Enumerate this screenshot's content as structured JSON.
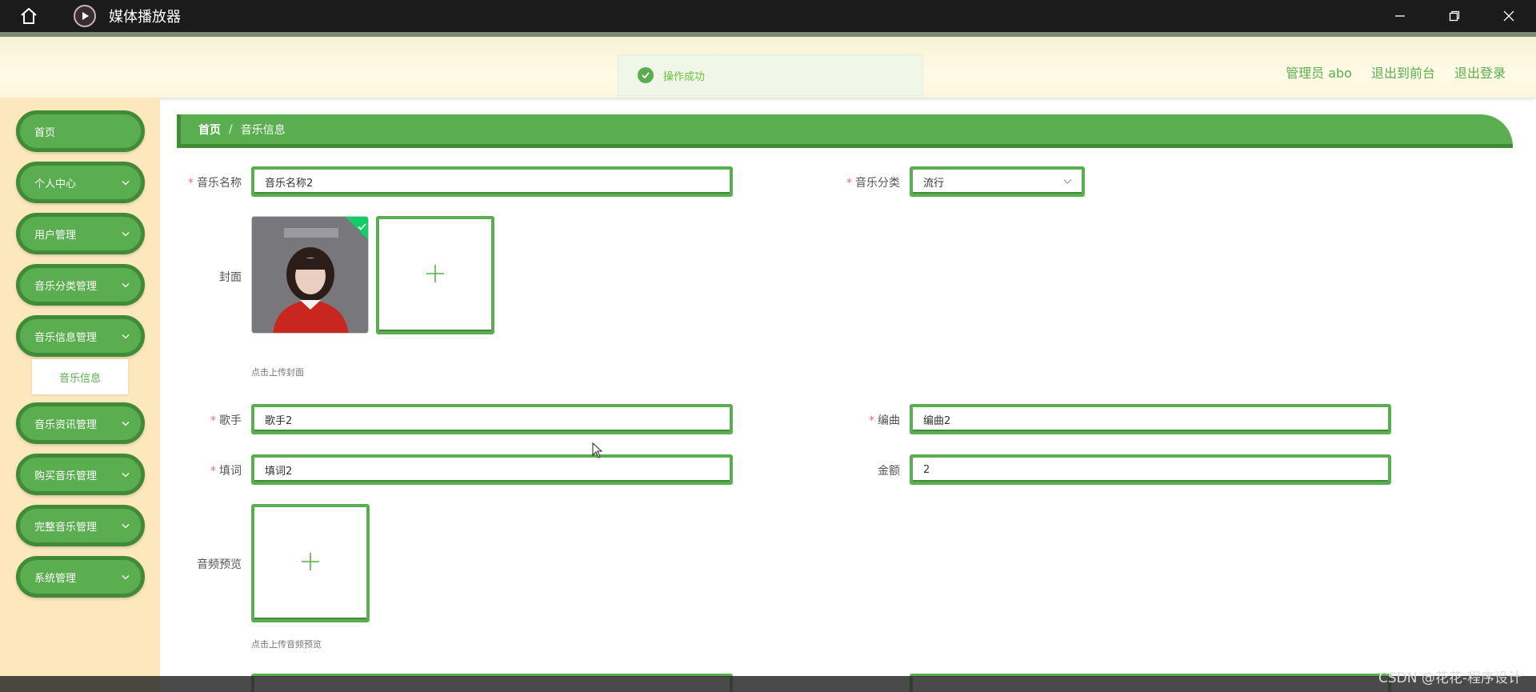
{
  "app": {
    "title": "媒体播放器"
  },
  "header": {
    "toast": "操作成功",
    "user": "管理员 abo",
    "front_link": "退出到前台",
    "logout": "退出登录"
  },
  "sidebar": {
    "items": [
      {
        "label": "首页"
      },
      {
        "label": "个人中心"
      },
      {
        "label": "用户管理"
      },
      {
        "label": "音乐分类管理"
      },
      {
        "label": "音乐信息管理"
      },
      {
        "label": "音乐资讯管理"
      },
      {
        "label": "购买音乐管理"
      },
      {
        "label": "完整音乐管理"
      },
      {
        "label": "系统管理"
      }
    ],
    "submenu": {
      "label": "音乐信息"
    }
  },
  "breadcrumb": {
    "home": "首页",
    "sep": "/",
    "current": "音乐信息"
  },
  "form": {
    "music_name": {
      "label": "音乐名称",
      "value": "音乐名称2"
    },
    "category": {
      "label": "音乐分类",
      "value": "流行"
    },
    "cover": {
      "label": "封面",
      "hint": "点击上传封面"
    },
    "singer": {
      "label": "歌手",
      "value": "歌手2"
    },
    "arranger": {
      "label": "编曲",
      "value": "编曲2"
    },
    "lyricist": {
      "label": "填词",
      "value": "填词2"
    },
    "amount": {
      "label": "金额",
      "value": "2"
    },
    "audio_preview": {
      "label": "音频预览",
      "hint": "点击上传音频预览"
    }
  },
  "watermark": "CSDN @花花-程序设计"
}
